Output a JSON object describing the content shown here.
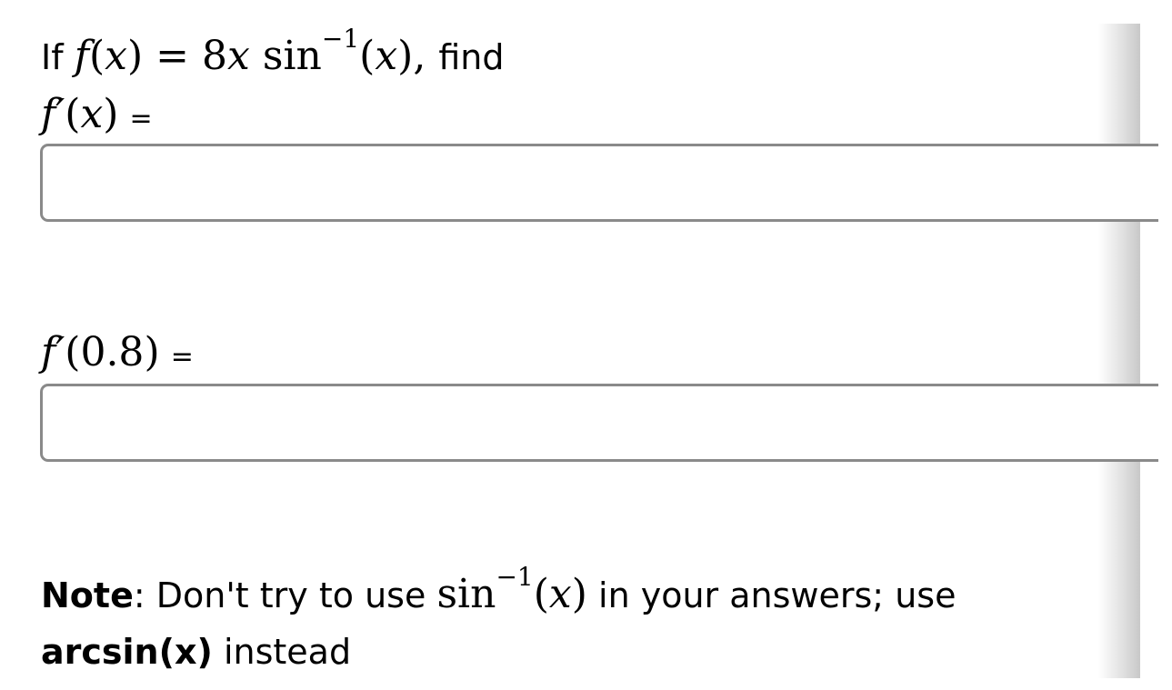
{
  "question": {
    "prefix": "If",
    "func_name": "f",
    "var": "x",
    "lparen": "(",
    "rparen": ")",
    "equals": "=",
    "coeff": "8",
    "func_op": "sin",
    "exponent": "−1",
    "comma": ",",
    "suffix": "find"
  },
  "part1": {
    "label_func": "f′",
    "label_var": "x",
    "lparen": "(",
    "rparen": ")",
    "equals": "=",
    "answer_value": ""
  },
  "part2": {
    "label_func": "f′",
    "label_arg": "0.8",
    "lparen": "(",
    "rparen": ")",
    "equals": "=",
    "answer_value": ""
  },
  "note": {
    "bold_label": "Note",
    "colon": ":",
    "text_before": "Don't try to use",
    "func_op": "sin",
    "exponent": "−1",
    "var": "x",
    "lparen": "(",
    "rparen": ")",
    "text_after": "in your answers; use",
    "bold_alt": "arcsin(x)",
    "text_end": "instead"
  }
}
